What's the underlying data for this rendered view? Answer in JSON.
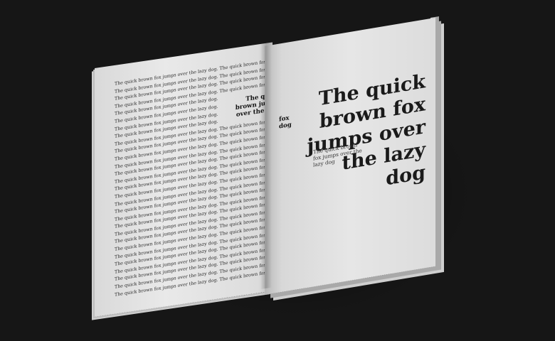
{
  "scene": {
    "description_free": true,
    "colors": {
      "background": "#161616",
      "paper": "#e6e6e6",
      "ink": "#1a1a1a"
    }
  },
  "left_page": {
    "body_line": "The quick brown fox jumps over the lazy dog. The quick brown fox jumps over the lazy dog.",
    "short_line": "The quick brown fox jumps over the lazy dog.",
    "heading": "The quick brown jumps over the lazy"
  },
  "right_page": {
    "side_word": "fox dog",
    "title": "The quick brown fox jumps over the lazy dog",
    "small_text": "The quick brown fox jumps over the lazy dog"
  }
}
